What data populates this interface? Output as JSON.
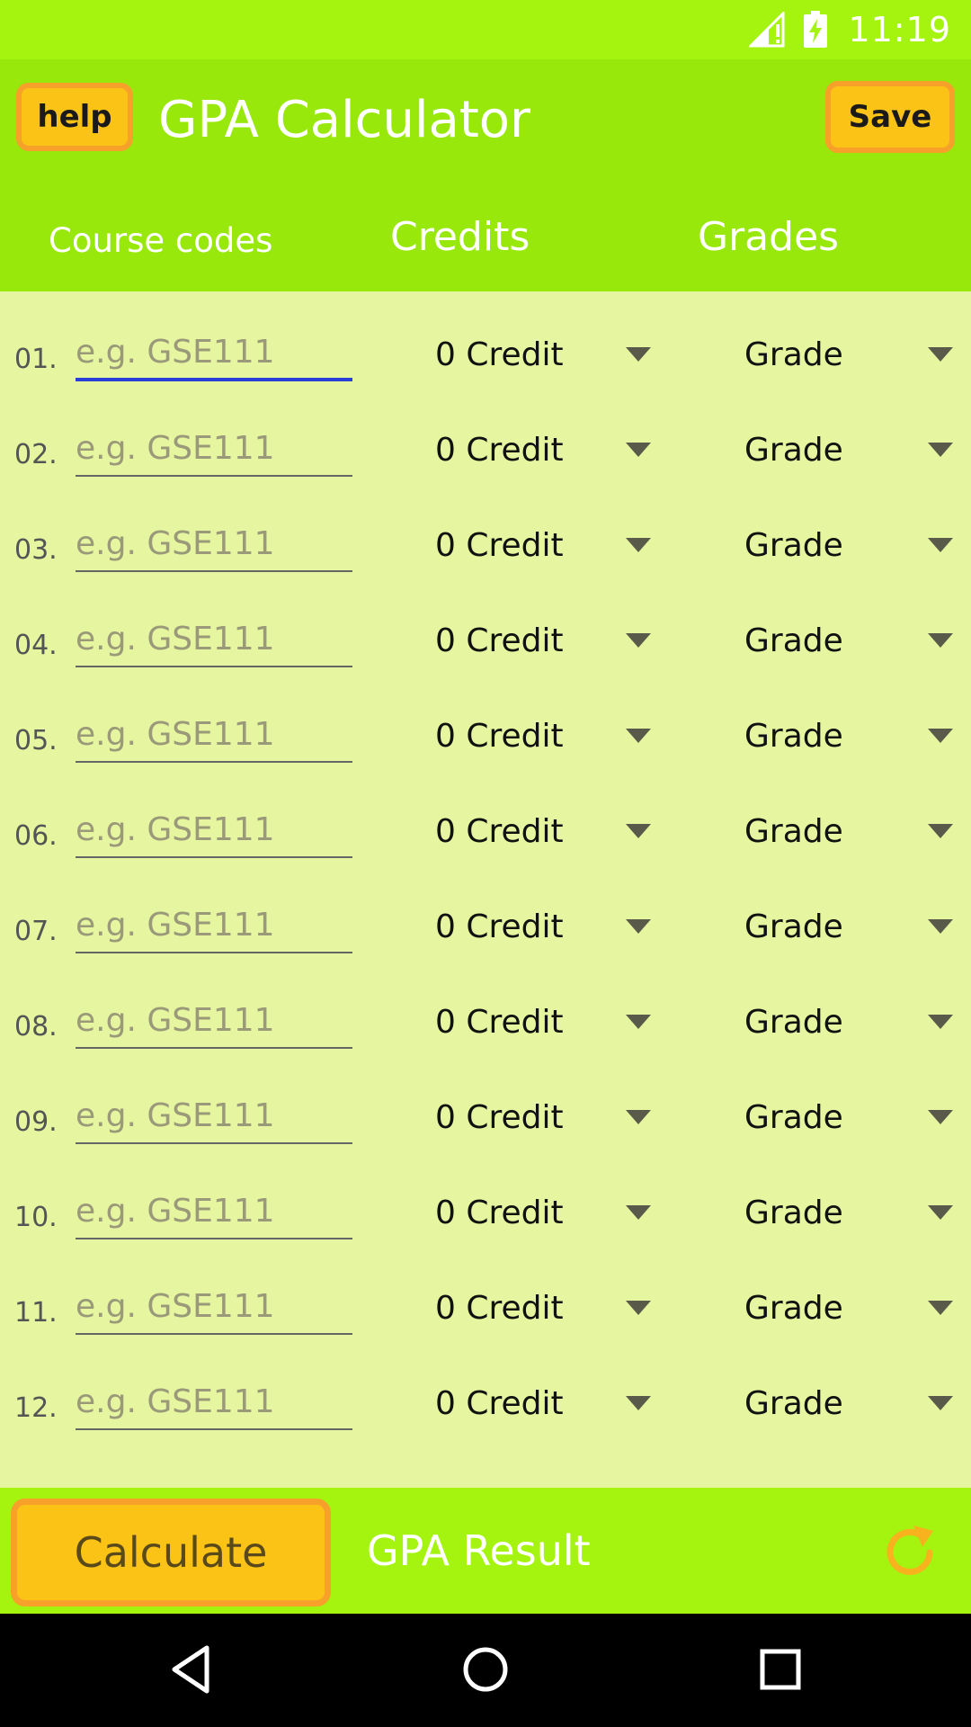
{
  "status_bar": {
    "time": "11:19",
    "icons": [
      "signal-icon",
      "battery-charging-icon"
    ]
  },
  "app_bar": {
    "help_label": "help",
    "title": "GPA Calculator",
    "save_label": "Save"
  },
  "columns": {
    "course_codes": "Course codes",
    "credits": "Credits",
    "grades": "Grades"
  },
  "courses": [
    {
      "number": "01.",
      "placeholder": "e.g. GSE111",
      "value": "",
      "credit": "0 Credit",
      "grade": "Grade"
    },
    {
      "number": "02.",
      "placeholder": "e.g. GSE111",
      "value": "",
      "credit": "0 Credit",
      "grade": "Grade"
    },
    {
      "number": "03.",
      "placeholder": "e.g. GSE111",
      "value": "",
      "credit": "0 Credit",
      "grade": "Grade"
    },
    {
      "number": "04.",
      "placeholder": "e.g. GSE111",
      "value": "",
      "credit": "0 Credit",
      "grade": "Grade"
    },
    {
      "number": "05.",
      "placeholder": "e.g. GSE111",
      "value": "",
      "credit": "0 Credit",
      "grade": "Grade"
    },
    {
      "number": "06.",
      "placeholder": "e.g. GSE111",
      "value": "",
      "credit": "0 Credit",
      "grade": "Grade"
    },
    {
      "number": "07.",
      "placeholder": "e.g. GSE111",
      "value": "",
      "credit": "0 Credit",
      "grade": "Grade"
    },
    {
      "number": "08.",
      "placeholder": "e.g. GSE111",
      "value": "",
      "credit": "0 Credit",
      "grade": "Grade"
    },
    {
      "number": "09.",
      "placeholder": "e.g. GSE111",
      "value": "",
      "credit": "0 Credit",
      "grade": "Grade"
    },
    {
      "number": "10.",
      "placeholder": "e.g. GSE111",
      "value": "",
      "credit": "0 Credit",
      "grade": "Grade"
    },
    {
      "number": "11.",
      "placeholder": "e.g. GSE111",
      "value": "",
      "credit": "0 Credit",
      "grade": "Grade"
    },
    {
      "number": "12.",
      "placeholder": "e.g. GSE111",
      "value": "",
      "credit": "0 Credit",
      "grade": "Grade"
    }
  ],
  "bottom_bar": {
    "calculate_label": "Calculate",
    "result_label": "GPA Result",
    "refresh_icon": "refresh-icon"
  },
  "nav_bar": {
    "icons": [
      "back-icon",
      "home-icon",
      "recents-icon"
    ]
  },
  "colors": {
    "status_bar": "#a4f40f",
    "app_bar": "#98e80c",
    "background": "#e6f59f",
    "button_fill": "#fcc317",
    "button_border": "#f7a12a",
    "focus_underline": "#2a3fd8"
  }
}
